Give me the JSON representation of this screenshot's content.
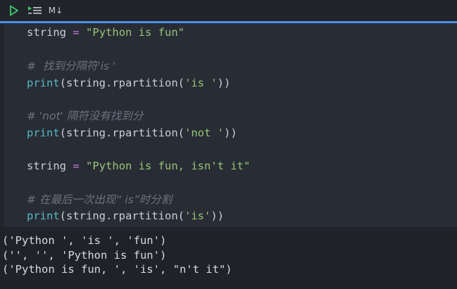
{
  "toolbar": {
    "run_icon": "play-icon",
    "run_all_icon": "run-all-icon",
    "markdown_label": "M↓"
  },
  "code": {
    "l1": {
      "var": "string",
      "op": "=",
      "str": "\"Python is fun\""
    },
    "l2": {
      "comment": "#  找到分隔符'is '"
    },
    "l3": {
      "fn": "print",
      "open": "(",
      "obj": "string.rpartition(",
      "str": "'is '",
      "close": "))"
    },
    "l4": {
      "comment": "# 'not' 隔符没有找到分"
    },
    "l5": {
      "fn": "print",
      "open": "(",
      "obj": "string.rpartition(",
      "str": "'not '",
      "close": "))"
    },
    "l6": {
      "var": "string",
      "op": "=",
      "str": "\"Python is fun, isn't it\""
    },
    "l7": {
      "comment": "# 在最后一次出现“ is”时分割"
    },
    "l8": {
      "fn": "print",
      "open": "(",
      "obj": "string.rpartition(",
      "str": "'is'",
      "close": "))"
    }
  },
  "output": {
    "lines": [
      "('Python ', 'is ', 'fun')",
      "('', '', 'Python is fun')",
      "('Python is fun, ', 'is', \"n't it\")"
    ]
  },
  "colors": {
    "accent": "#4a8fe7",
    "string": "#98c379",
    "function": "#56b6c2",
    "operator": "#c678dd",
    "comment": "#6b7280"
  }
}
